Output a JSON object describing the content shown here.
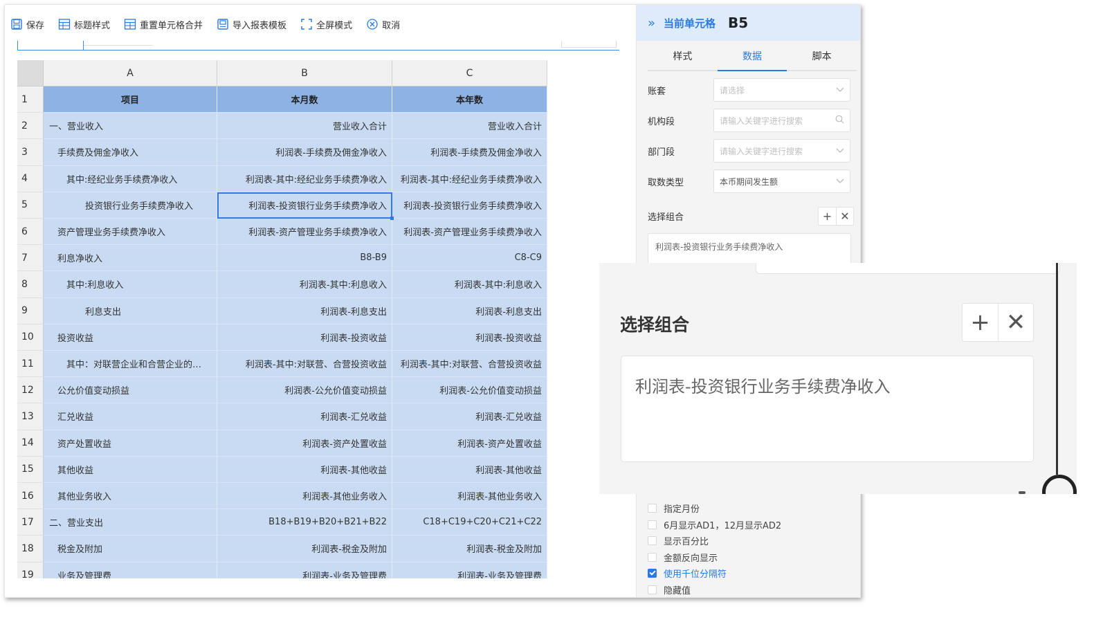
{
  "toolbar": {
    "items": [
      {
        "label": "保存",
        "icon": "save-icon"
      },
      {
        "label": "标题样式",
        "icon": "title-style-icon"
      },
      {
        "label": "重置单元格合并",
        "icon": "reset-merge-icon"
      },
      {
        "label": "导入报表模板",
        "icon": "import-template-icon"
      },
      {
        "label": "全屏模式",
        "icon": "fullscreen-icon"
      },
      {
        "label": "取消",
        "icon": "cancel-icon"
      }
    ]
  },
  "sheet": {
    "columns": [
      "A",
      "B",
      "C"
    ],
    "rows": [
      {
        "n": "1",
        "a": "项目",
        "b": "本月数",
        "c": "本年数"
      },
      {
        "n": "2",
        "a": "一、营业收入",
        "b": "营业收入合计",
        "c": "营业收入合计"
      },
      {
        "n": "3",
        "a": "手续费及佣金净收入",
        "b": "利润表-手续费及佣金净收入",
        "c": "利润表-手续费及佣金净收入"
      },
      {
        "n": "4",
        "a": "其中:经纪业务手续费净收入",
        "b": "利润表-其中:经纪业务手续费净收入",
        "c": "利润表-其中:经纪业务手续费净收入"
      },
      {
        "n": "5",
        "a": "投资银行业务手续费净收入",
        "b": "利润表-投资银行业务手续费净收入",
        "c": "利润表-投资银行业务手续费净收入"
      },
      {
        "n": "6",
        "a": "资产管理业务手续费净收入",
        "b": "利润表-资产管理业务手续费净收入",
        "c": "利润表-资产管理业务手续费净收入"
      },
      {
        "n": "7",
        "a": "利息净收入",
        "b": "B8-B9",
        "c": "C8-C9"
      },
      {
        "n": "8",
        "a": "其中:利息收入",
        "b": "利润表-其中:利息收入",
        "c": "利润表-其中:利息收入"
      },
      {
        "n": "9",
        "a": "利息支出",
        "b": "利润表-利息支出",
        "c": "利润表-利息支出"
      },
      {
        "n": "10",
        "a": "投资收益",
        "b": "利润表-投资收益",
        "c": "利润表-投资收益"
      },
      {
        "n": "11",
        "a": "其中：对联营企业和合营企业的…",
        "b": "利润表-其中:对联营、合营投资收益",
        "c": "利润表-其中:对联营、合营投资收益"
      },
      {
        "n": "12",
        "a": "公允价值变动损益",
        "b": "利润表-公允价值变动损益",
        "c": "利润表-公允价值变动损益"
      },
      {
        "n": "13",
        "a": "汇兑收益",
        "b": "利润表-汇兑收益",
        "c": "利润表-汇兑收益"
      },
      {
        "n": "14",
        "a": "资产处置收益",
        "b": "利润表-资产处置收益",
        "c": "利润表-资产处置收益"
      },
      {
        "n": "15",
        "a": "其他收益",
        "b": "利润表-其他收益",
        "c": "利润表-其他收益"
      },
      {
        "n": "16",
        "a": "其他业务收入",
        "b": "利润表-其他业务收入",
        "c": "利润表-其他业务收入"
      },
      {
        "n": "17",
        "a": "二、营业支出",
        "b": "B18+B19+B20+B21+B22",
        "c": "C18+C19+C20+C21+C22"
      },
      {
        "n": "18",
        "a": "税金及附加",
        "b": "利润表-税金及附加",
        "c": "利润表-税金及附加"
      },
      {
        "n": "19",
        "a": "业务及管理费",
        "b": "利润表-业务及管理费",
        "c": "利润表-业务及管理费"
      }
    ],
    "selected_cell": "B5"
  },
  "panel": {
    "title": "当前单元格",
    "cell_ref": "B5",
    "tabs": [
      "样式",
      "数据",
      "脚本"
    ],
    "active_tab": "数据",
    "fields": [
      {
        "label": "账套",
        "placeholder": "请选择",
        "icon": "chevron-down-icon"
      },
      {
        "label": "机构段",
        "placeholder": "请输入关键字进行搜索",
        "icon": "search-icon"
      },
      {
        "label": "部门段",
        "placeholder": "请输入关键字进行搜索",
        "icon": "chevron-down-icon"
      },
      {
        "label": "取数类型",
        "value": "本币期间发生额",
        "icon": "chevron-down-icon"
      }
    ],
    "combo": {
      "label": "选择组合",
      "value": "利润表-投资银行业务手续费净收入"
    },
    "checkboxes": [
      {
        "label": "指定月份",
        "checked": false
      },
      {
        "label": "6月显示AD1，12月显示AD2",
        "checked": false
      },
      {
        "label": "显示百分比",
        "checked": false
      },
      {
        "label": "金额反向显示",
        "checked": false
      },
      {
        "label": "使用千位分隔符",
        "checked": true
      },
      {
        "label": "隐藏值",
        "checked": false
      }
    ]
  },
  "zoom": {
    "label": "选择组合",
    "value": "利润表-投资银行业务手续费净收入"
  },
  "colors": {
    "accent": "#2a7ae2",
    "header_fill": "#8fb2e4",
    "cell_fill": "#c9dbf2"
  }
}
